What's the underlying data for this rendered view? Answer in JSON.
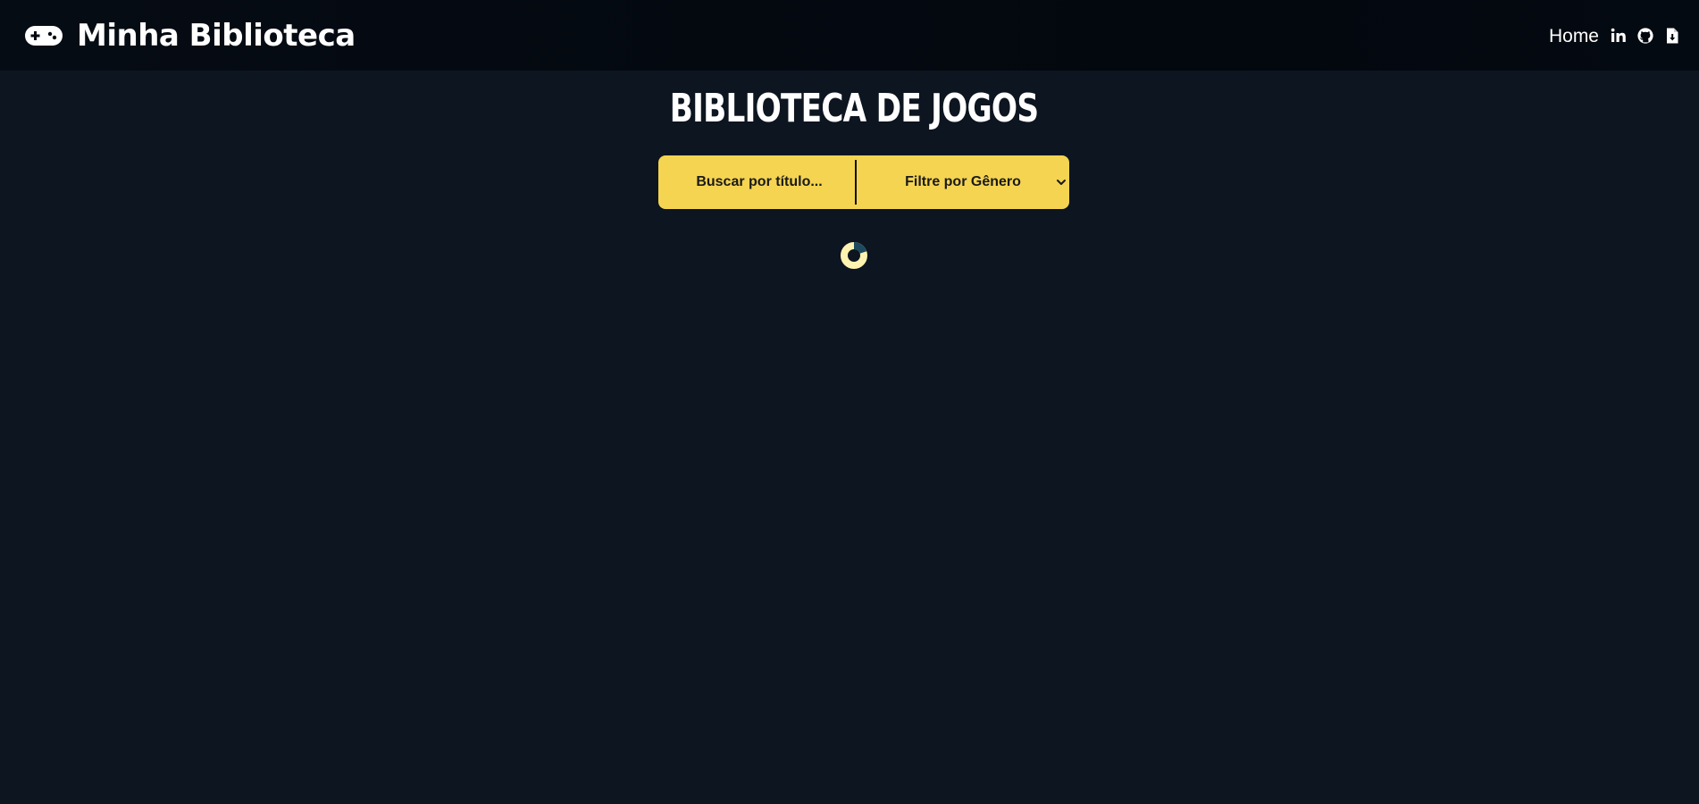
{
  "navbar": {
    "brand_icon": "gamepad-icon",
    "brand_title": "Minha Biblioteca",
    "links": {
      "home_label": "Home"
    },
    "icons": [
      "linkedin-icon",
      "github-icon",
      "file-download-icon"
    ]
  },
  "main": {
    "title": "BIBLIOTECA DE JOGOS",
    "search": {
      "placeholder": "Buscar por título...",
      "value": ""
    },
    "genre_filter": {
      "selected_label": "Filtre por Gênero"
    },
    "loading_indicator": "spinner-icon"
  },
  "colors": {
    "background": "#0d1520",
    "navbar": "#03070e",
    "accent_yellow": "#f5d451",
    "spinner_light": "#fff3b0",
    "spinner_dark": "#1e4a5e"
  }
}
